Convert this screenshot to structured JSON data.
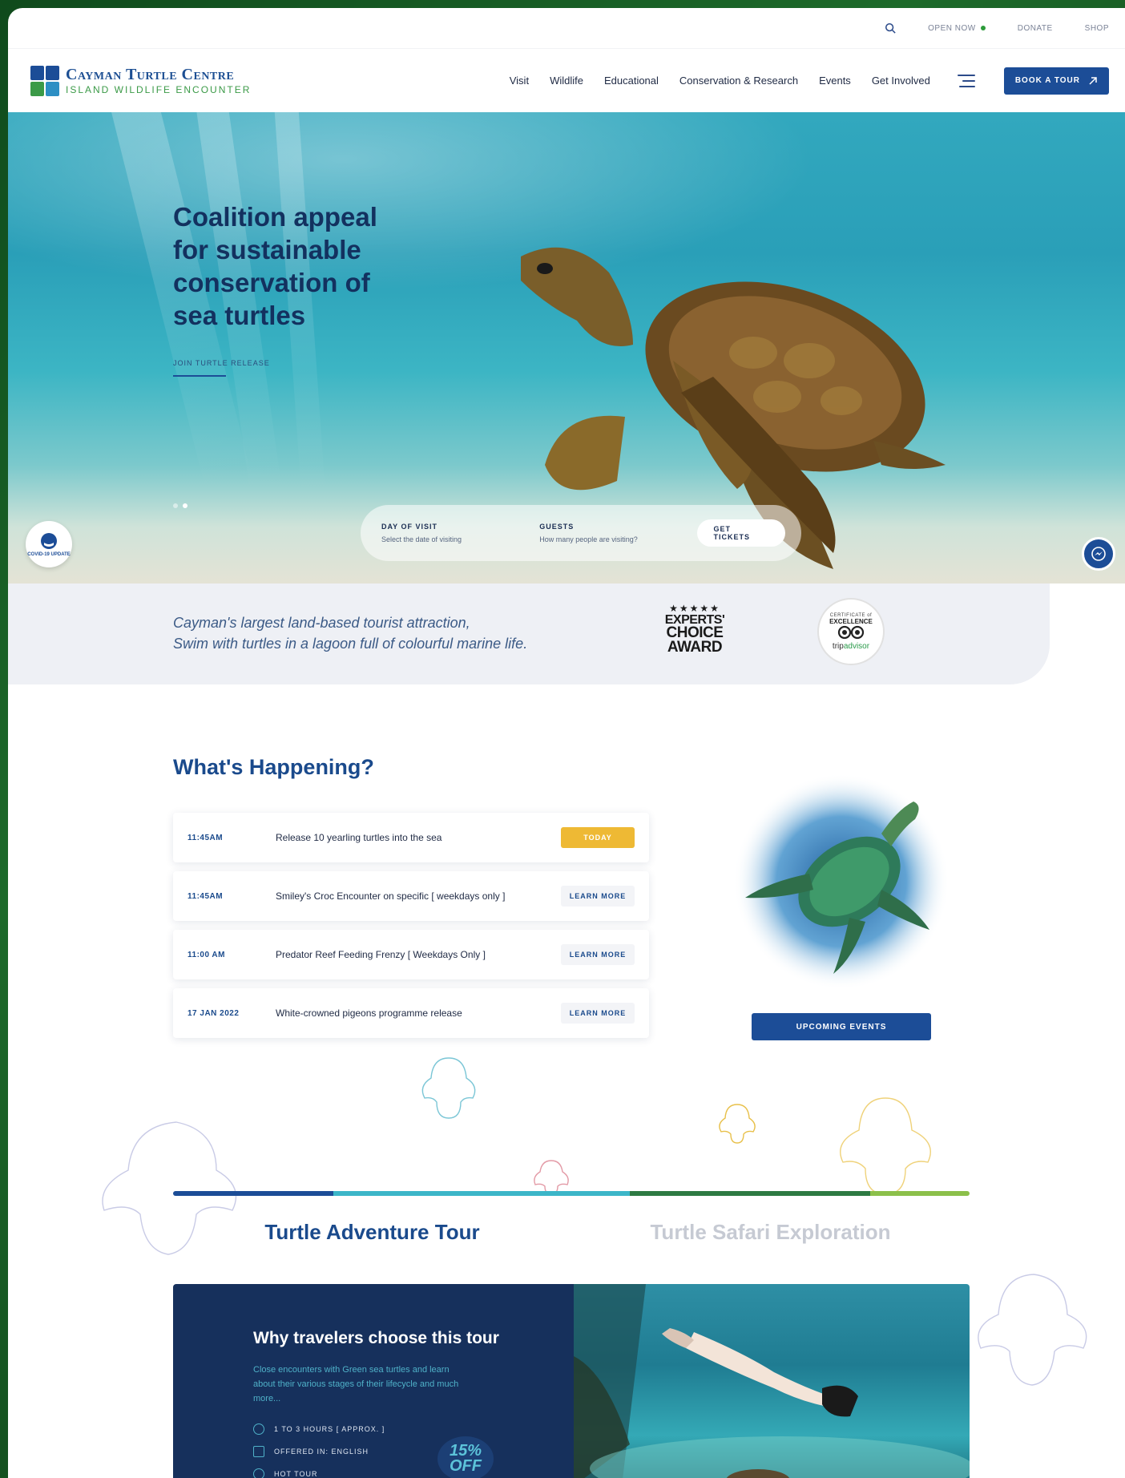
{
  "utility": {
    "open_now": "OPEN NOW",
    "donate": "DONATE",
    "shop": "SHOP",
    "status_color": "#2d9b3a"
  },
  "header": {
    "logo_title": "Cayman Turtle Centre",
    "logo_subtitle": "ISLAND WILDLIFE ENCOUNTER",
    "nav": [
      "Visit",
      "Wildlife",
      "Educational",
      "Conservation & Research",
      "Events",
      "Get Involved"
    ],
    "book_label": "BOOK A TOUR",
    "brand_color": "#1c4d97"
  },
  "hero": {
    "title": "Coalition appeal for sustainable conservation of sea turtles",
    "link": "JOIN TURTLE RELEASE",
    "covid_label": "COVID-19 UPDATE",
    "booking": {
      "day_label": "DAY OF VISIT",
      "day_hint": "Select the date of visiting",
      "guests_label": "GUESTS",
      "guests_hint": "How many people are visiting?",
      "cta": "GET TICKETS"
    }
  },
  "intro": {
    "line1": "Cayman's largest land-based tourist attraction,",
    "line2": "Swim with turtles in a lagoon full of colourful marine life.",
    "award_lines": [
      "EXPERTS'",
      "CHOICE",
      "AWARD"
    ],
    "trip_top": "CERTIFICATE of",
    "trip_mid": "EXCELLENCE",
    "trip_name_a": "trip",
    "trip_name_b": "advisor"
  },
  "happening": {
    "title": "What's Happening?",
    "events": [
      {
        "time": "11:45AM",
        "desc": "Release 10 yearling turtles into the sea",
        "action": "TODAY"
      },
      {
        "time": "11:45AM",
        "desc": "Smiley's Croc Encounter on specific [ weekdays only ]",
        "action": "LEARN MORE"
      },
      {
        "time": "11:00 AM",
        "desc": "Predator Reef Feeding Frenzy [ Weekdays Only ]",
        "action": "LEARN MORE"
      },
      {
        "time": "17 JAN 2022",
        "desc": "White-crowned pigeons programme release",
        "action": "LEARN MORE"
      }
    ],
    "upcoming": "UPCOMING EVENTS",
    "today_color": "#eeb934"
  },
  "tours": {
    "tabs": [
      "Turtle Adventure Tour",
      "Turtle Safari Exploration"
    ],
    "card_title": "Why travelers choose this tour",
    "card_desc": "Close encounters with Green sea turtles and learn about their various stages of their lifecycle and much more...",
    "features": [
      "1 TO 3 HOURS [ APPROX. ]",
      "OFFERED IN: ENGLISH",
      "HOT TOUR"
    ],
    "discount": "15% OFF"
  }
}
